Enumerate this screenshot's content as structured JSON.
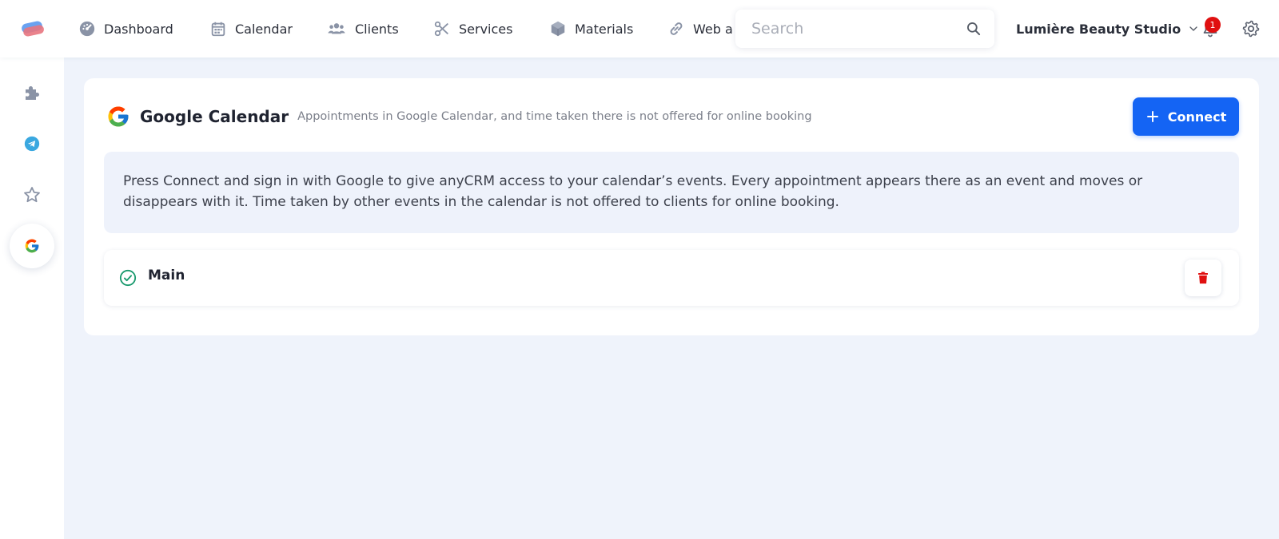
{
  "nav": {
    "items": [
      {
        "label": "Dashboard",
        "icon": "dashboard-icon"
      },
      {
        "label": "Calendar",
        "icon": "calendar-icon"
      },
      {
        "label": "Clients",
        "icon": "clients-icon"
      },
      {
        "label": "Services",
        "icon": "scissors-icon"
      },
      {
        "label": "Materials",
        "icon": "box-icon"
      },
      {
        "label": "Web a",
        "icon": "link-icon"
      }
    ]
  },
  "search": {
    "placeholder": "Search"
  },
  "header": {
    "org_name": "Lumière Beauty Studio",
    "notification_count": "1"
  },
  "sidebar": {
    "items": [
      {
        "icon": "puzzle-icon",
        "active": false
      },
      {
        "icon": "telegram-icon",
        "active": false
      },
      {
        "icon": "star-icon",
        "active": false
      },
      {
        "icon": "google-icon",
        "active": true
      }
    ]
  },
  "integration": {
    "title": "Google Calendar",
    "subtitle": "Appointments in Google Calendar, and time taken there is not offered for online booking",
    "connect_label": "Connect",
    "info_text": "Press Connect and sign in with Google to give anyCRM access to your calendar’s events. Every appointment appears there as an event and moves or disappears with it. Time taken by other events in the calendar is not offered to clients for online booking.",
    "calendars": [
      {
        "name": "Main",
        "status": "connected"
      }
    ]
  },
  "colors": {
    "accent": "#1464f4",
    "background": "#eff3fb",
    "danger": "#e01010",
    "success": "#1a9a6e"
  }
}
